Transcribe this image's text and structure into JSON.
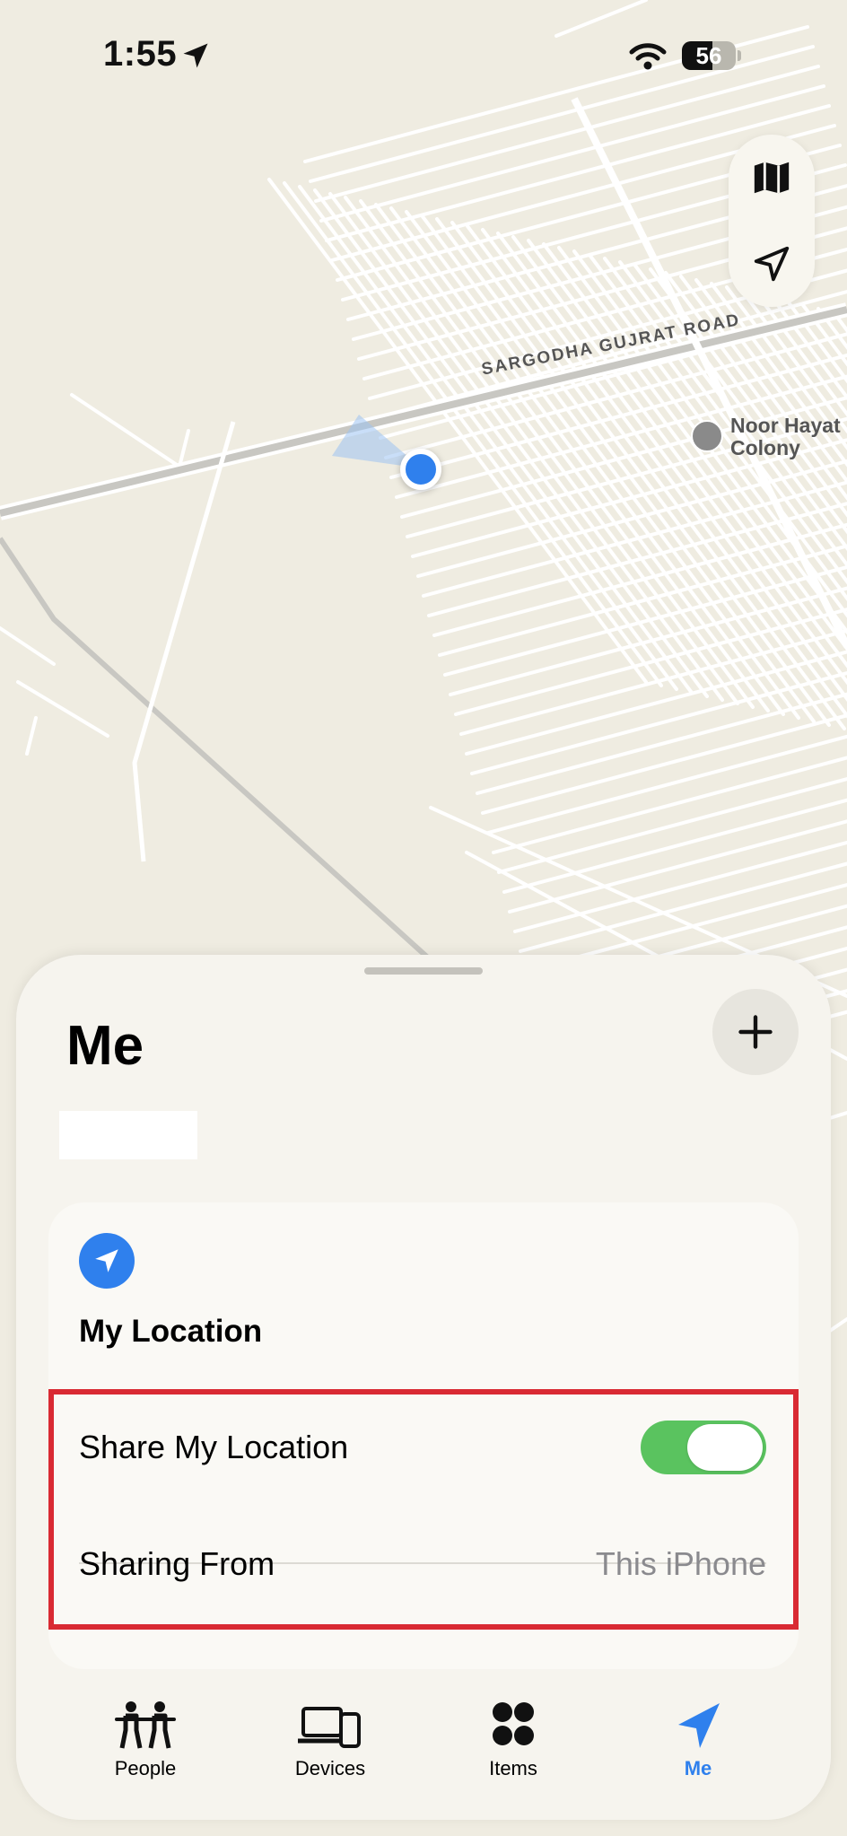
{
  "status_bar": {
    "time": "1:55",
    "battery_level": "56",
    "battery_fraction": 0.56
  },
  "map": {
    "road_label": "SARGODHA GUJRAT ROAD",
    "poi_name": "Noor Hayat Colony"
  },
  "map_controls": {
    "map_mode_icon": "map-icon",
    "locate_icon": "location-arrow-icon"
  },
  "sheet": {
    "title": "Me",
    "add_icon": "plus-icon",
    "card": {
      "icon": "location-arrow-icon",
      "title": "My Location",
      "rows": [
        {
          "label": "Share My Location",
          "toggle_on": true
        },
        {
          "label": "Sharing From",
          "value": "This iPhone"
        }
      ]
    }
  },
  "tabs": [
    {
      "label": "People",
      "icon": "people-icon",
      "active": false
    },
    {
      "label": "Devices",
      "icon": "devices-icon",
      "active": false
    },
    {
      "label": "Items",
      "icon": "items-icon",
      "active": false
    },
    {
      "label": "Me",
      "icon": "location-arrow-icon",
      "active": true
    }
  ],
  "colors": {
    "accent": "#2f80ed",
    "toggle_on": "#5ac35f",
    "highlight": "#d92a33",
    "map_background": "#efece1"
  }
}
